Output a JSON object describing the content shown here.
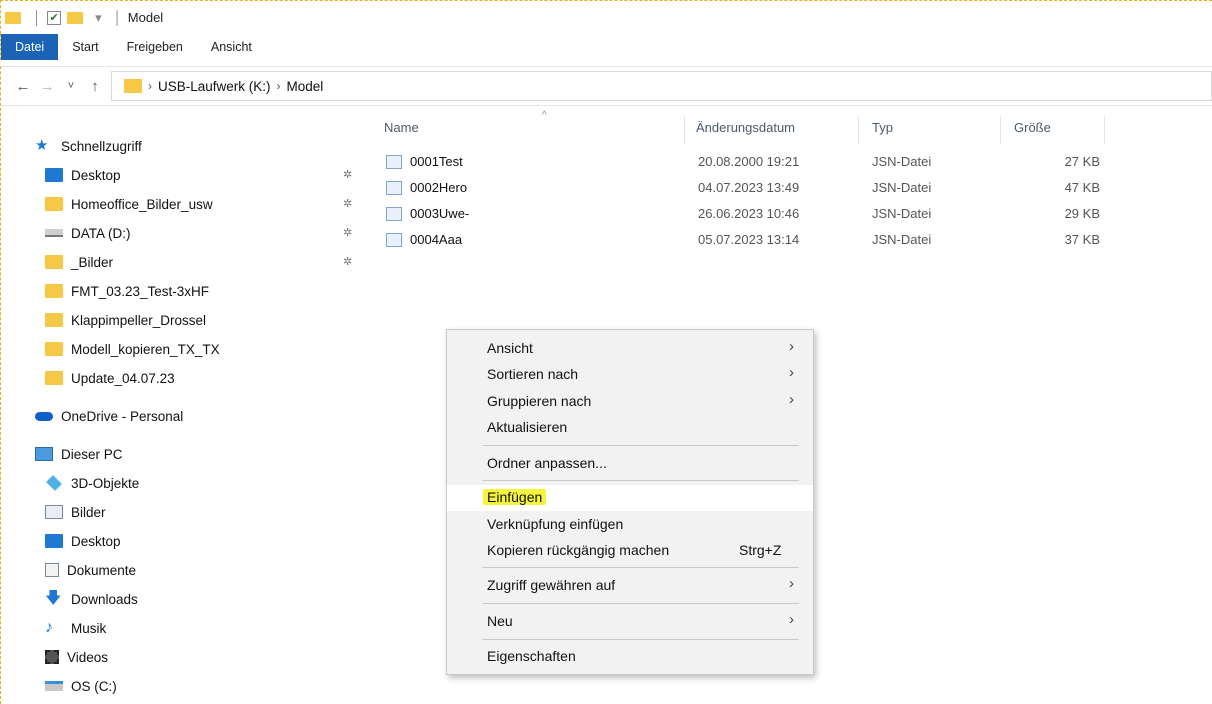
{
  "window": {
    "title": "Model",
    "quick_access_sep": "│"
  },
  "ribbon": {
    "tabs": [
      "Datei",
      "Start",
      "Freigeben",
      "Ansicht"
    ]
  },
  "address": {
    "back": "←",
    "forward": "→",
    "recent": "˅",
    "up": "↑",
    "breadcrumb": [
      "USB-Laufwerk (K:)",
      "Model"
    ],
    "crumb_sep": "›"
  },
  "sidebar": {
    "quick_access": "Schnellzugriff",
    "pinned": [
      {
        "label": "Desktop",
        "icon": "desktop-icon"
      },
      {
        "label": "Homeoffice_Bilder_usw",
        "icon": "folder-icon"
      },
      {
        "label": "DATA (D:)",
        "icon": "drive-icon"
      },
      {
        "label": "_Bilder",
        "icon": "folder-icon"
      }
    ],
    "folders": [
      "FMT_03.23_Test-3xHF",
      "Klappimpeller_Drossel",
      "Modell_kopieren_TX_TX",
      "Update_04.07.23"
    ],
    "onedrive": "OneDrive - Personal",
    "this_pc": "Dieser PC",
    "pc_items": [
      "3D-Objekte",
      "Bilder",
      "Desktop",
      "Dokumente",
      "Downloads",
      "Musik",
      "Videos",
      "OS (C:)"
    ],
    "pin_glyph": "✲"
  },
  "filelist": {
    "columns": [
      "Name",
      "Änderungsdatum",
      "Typ",
      "Größe"
    ],
    "sort_glyph": "^",
    "rows": [
      {
        "name": "0001Test",
        "date": "20.08.2000 19:21",
        "type": "JSN-Datei",
        "size": "27 KB"
      },
      {
        "name": "0002Hero",
        "date": "04.07.2023 13:49",
        "type": "JSN-Datei",
        "size": "47 KB"
      },
      {
        "name": "0003Uwe-",
        "date": "26.06.2023 10:46",
        "type": "JSN-Datei",
        "size": "29 KB"
      },
      {
        "name": "0004Aaa",
        "date": "05.07.2023 13:14",
        "type": "JSN-Datei",
        "size": "37 KB"
      }
    ]
  },
  "context_menu": {
    "ansicht": "Ansicht",
    "sortieren": "Sortieren nach",
    "gruppieren": "Gruppieren nach",
    "aktualisieren": "Aktualisieren",
    "ordner_anpassen": "Ordner anpassen...",
    "einfuegen": "Einfügen",
    "verknuepfung": "Verknüpfung einfügen",
    "kopieren_rueck": "Kopieren rückgängig machen",
    "kopieren_shortcut": "Strg+Z",
    "zugriff": "Zugriff gewähren auf",
    "neu": "Neu",
    "eigenschaften": "Eigenschaften",
    "submenu_arrow": "›",
    "highlight_color": "#f7f43c"
  }
}
